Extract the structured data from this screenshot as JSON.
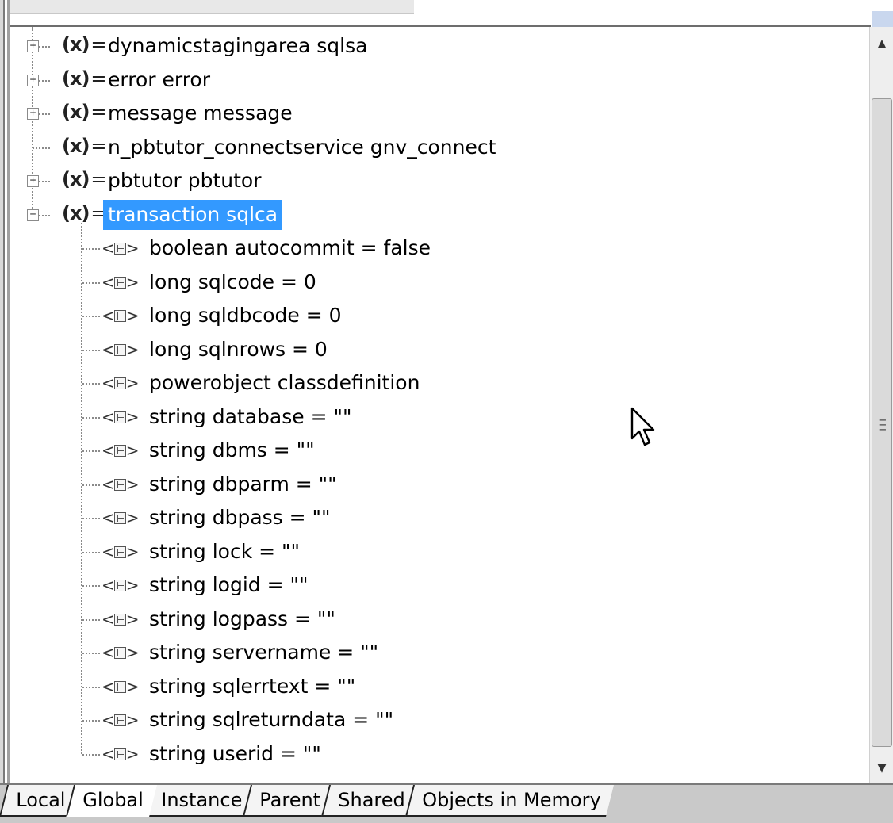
{
  "tree": {
    "top_items": [
      {
        "label": "dynamicstagingarea sqlsa",
        "expander": "+",
        "selected": false
      },
      {
        "label": "error error",
        "expander": "+",
        "selected": false
      },
      {
        "label": "message message",
        "expander": "+",
        "selected": false
      },
      {
        "label": "n_pbtutor_connectservice gnv_connect",
        "expander": "",
        "selected": false
      },
      {
        "label": "pbtutor pbtutor",
        "expander": "+",
        "selected": false
      },
      {
        "label": "transaction sqlca",
        "expander": "−",
        "selected": true
      }
    ],
    "var_icon": "(x)",
    "var_icon_eq": "=",
    "field_icon_left": "<",
    "field_icon_right": ">",
    "children": [
      "boolean autocommit = false",
      "long sqlcode = 0",
      "long sqldbcode = 0",
      "long sqlnrows = 0",
      "powerobject classdefinition",
      "string database = \"\"",
      "string dbms = \"\"",
      "string dbparm = \"\"",
      "string dbpass = \"\"",
      "string lock = \"\"",
      "string logid = \"\"",
      "string logpass = \"\"",
      "string servername = \"\"",
      "string sqlerrtext = \"\"",
      "string sqlreturndata = \"\"",
      "string userid = \"\""
    ]
  },
  "tabs": [
    {
      "label": "Local",
      "active": false
    },
    {
      "label": "Global",
      "active": true
    },
    {
      "label": "Instance",
      "active": false
    },
    {
      "label": "Parent",
      "active": false
    },
    {
      "label": "Shared",
      "active": false
    },
    {
      "label": "Objects in Memory",
      "active": false
    }
  ],
  "scrollbar": {
    "up_icon": "arrow-up-icon",
    "down_icon": "arrow-down-icon",
    "grip_icon": "grip-icon"
  },
  "colors": {
    "selection": "#3399ff",
    "tab_bar": "#c9c9c9"
  }
}
